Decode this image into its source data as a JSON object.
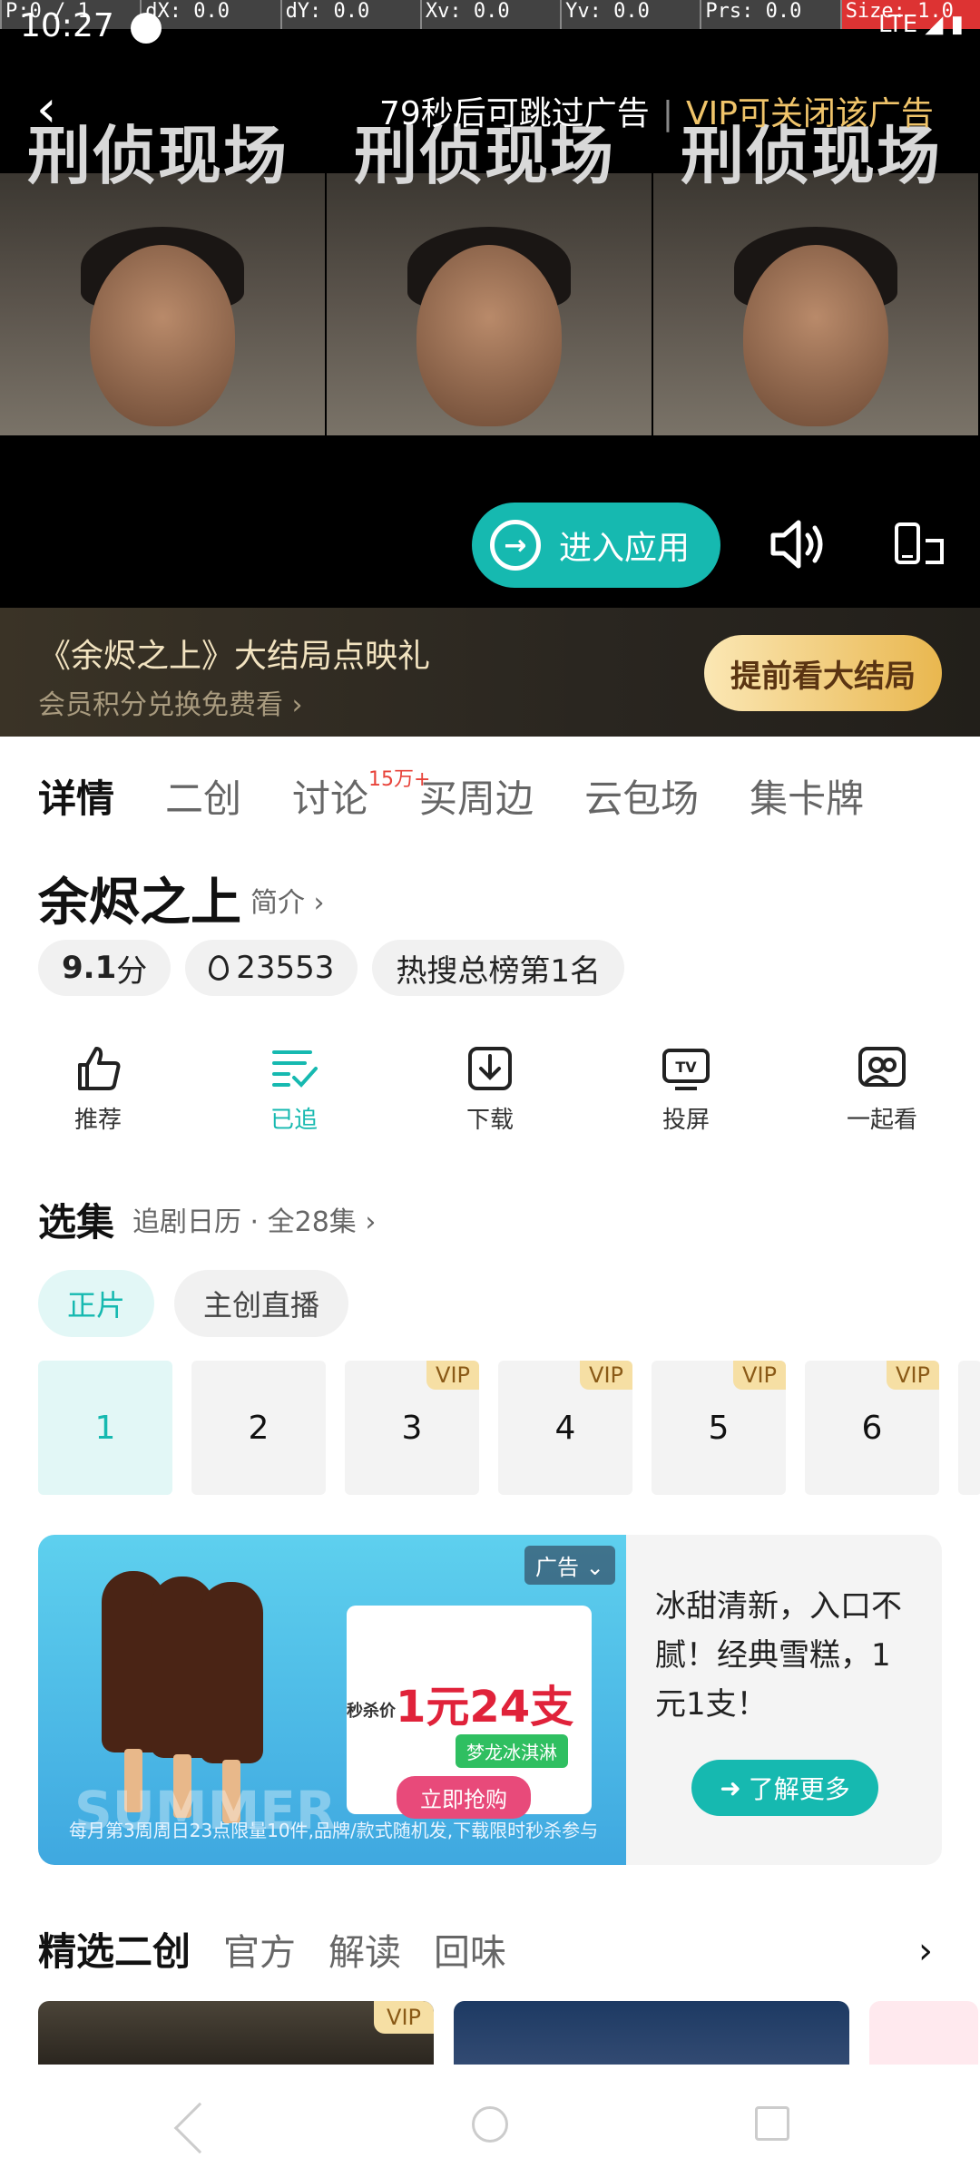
{
  "debug": {
    "items": [
      "P:0 / 1",
      "dX: 0.0",
      "dY: 0.0",
      "Xv: 0.0",
      "Yv: 0.0",
      "Prs: 0.0",
      "Size: 1.0"
    ]
  },
  "status": {
    "time": "10:27",
    "network": "LTE"
  },
  "video": {
    "show_title": "刑侦现场",
    "skip_text": "79秒后可跳过广告",
    "vip_close_text": "VIP可关闭该广告",
    "enter_app_label": "进入应用"
  },
  "promo": {
    "title": "《余烬之上》大结局点映礼",
    "subtitle": "会员积分兑换免费看 ›",
    "button_label": "提前看大结局"
  },
  "tabs": [
    {
      "label": "详情"
    },
    {
      "label": "二创"
    },
    {
      "label": "讨论",
      "badge": "15万+"
    },
    {
      "label": "买周边"
    },
    {
      "label": "云包场"
    },
    {
      "label": "集卡牌"
    }
  ],
  "show": {
    "title": "余烬之上",
    "intro_link": "简介 ›",
    "score": "9.1",
    "score_unit": "分",
    "heat": "23553",
    "rank": "热搜总榜第1名"
  },
  "actions": [
    {
      "label": "推荐",
      "icon": "thumbs-up-icon"
    },
    {
      "label": "已追",
      "icon": "followed-list-icon"
    },
    {
      "label": "下载",
      "icon": "download-icon"
    },
    {
      "label": "投屏",
      "icon": "tv-cast-icon"
    },
    {
      "label": "一起看",
      "icon": "watch-together-icon"
    }
  ],
  "episodes": {
    "section_title": "选集",
    "subtitle": "追剧日历 · 全28集 ›",
    "subtabs": [
      "正片",
      "主创直播"
    ],
    "items": [
      {
        "num": "1",
        "vip": ""
      },
      {
        "num": "2",
        "vip": ""
      },
      {
        "num": "3",
        "vip": "VIP"
      },
      {
        "num": "4",
        "vip": "VIP"
      },
      {
        "num": "5",
        "vip": "VIP"
      },
      {
        "num": "6",
        "vip": "VIP"
      }
    ]
  },
  "ad": {
    "tag": "广告 ⌄",
    "flash_label": "秒杀价",
    "price": "1元24支",
    "product": "梦龙冰淇淋",
    "grab_label": "立即抢购",
    "footnote": "每月第3周周日23点限量10件,品牌/款式随机发,下载限时秒杀参与",
    "watermark": "SUMMER",
    "copy": "冰甜清新，入口不腻！经典雪糕，1元1支！",
    "more_label": "了解更多"
  },
  "featured": {
    "title": "精选二创",
    "options": [
      "官方",
      "解读",
      "回味"
    ],
    "thumb_badge": "VIP"
  },
  "colors": {
    "accent": "#16b9b0",
    "gold": "#e9b74f",
    "vip_bg": "#f6dfa4",
    "red": "#e8433a"
  }
}
